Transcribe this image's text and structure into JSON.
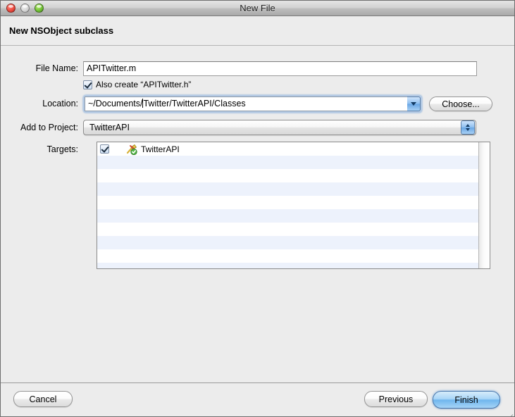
{
  "window": {
    "title": "New File",
    "traffic_lights": [
      "close-button",
      "minimize-button",
      "zoom-button"
    ]
  },
  "header": {
    "title": "New NSObject subclass"
  },
  "form": {
    "file_name": {
      "label": "File Name:",
      "value": "APITwitter.m",
      "placeholder": ""
    },
    "also_create": {
      "label": "Also create “APITwitter.h”",
      "checked": true
    },
    "location": {
      "label": "Location:",
      "value_before_caret": "~/Documents/",
      "value_after_caret": "Twitter/TwitterAPI/Classes",
      "full_value": "~/Documents/Twitter/TwitterAPI/Classes",
      "choose_button": "Choose..."
    },
    "add_to_project": {
      "label": "Add to Project:",
      "selected": "TwitterAPI",
      "options": [
        "TwitterAPI"
      ]
    },
    "targets": {
      "label": "Targets:",
      "rows": [
        {
          "checked": true,
          "name": "TwitterAPI",
          "icon": "target-hammer-icon"
        }
      ],
      "empty_row_count": 16
    }
  },
  "footer": {
    "cancel": "Cancel",
    "previous": "Previous",
    "finish": "Finish"
  },
  "colors": {
    "window_bg": "#ececec",
    "accent_blue": "#6fb6ee",
    "list_stripe": "#edf2fc",
    "field_border": "#9a9a9a"
  }
}
